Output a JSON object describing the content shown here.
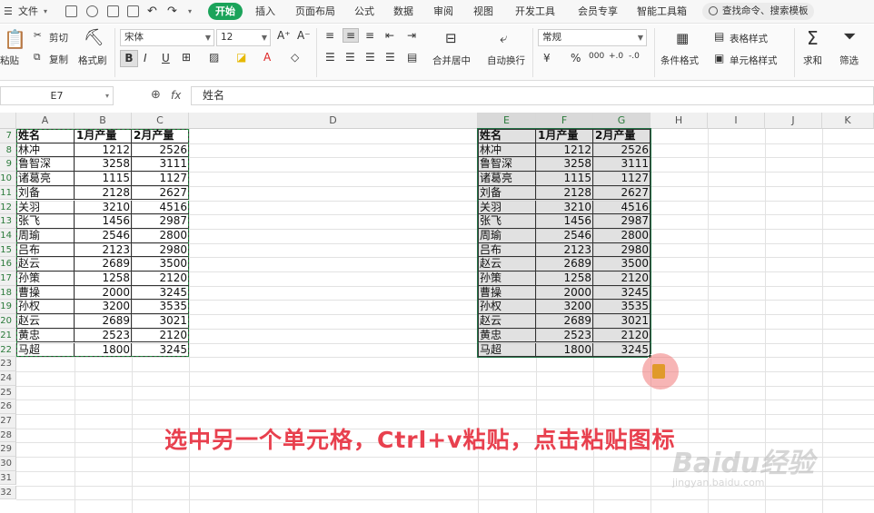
{
  "menubar": {
    "file": "文件",
    "tabs": [
      "开始",
      "插入",
      "页面布局",
      "公式",
      "数据",
      "审阅",
      "视图",
      "开发工具",
      "会员专享",
      "智能工具箱"
    ],
    "search": "查找命令、搜索模板"
  },
  "ribbon": {
    "paste": "粘贴",
    "cut": "剪切",
    "copy": "复制",
    "format_painter": "格式刷",
    "font_name": "宋体",
    "font_size": "12",
    "merge": "合并居中",
    "wrap": "自动换行",
    "number_format": "常规",
    "cond_format": "条件格式",
    "table_style": "表格样式",
    "cell_style": "单元格样式",
    "sum": "求和",
    "filter": "筛选",
    "currency": "¥",
    "percent": "%"
  },
  "formula_bar": {
    "name_box": "E7",
    "fx": "fx",
    "content": "姓名"
  },
  "grid": {
    "columns": [
      "A",
      "B",
      "C",
      "D",
      "E",
      "F",
      "G",
      "H",
      "I",
      "J",
      "K"
    ],
    "rows": [
      "7",
      "8",
      "9",
      "10",
      "11",
      "12",
      "13",
      "14",
      "15",
      "16",
      "17",
      "18",
      "19",
      "20",
      "21",
      "22",
      "23",
      "24",
      "25",
      "26",
      "27",
      "28",
      "29",
      "30",
      "31",
      "32"
    ],
    "headers": [
      "姓名",
      "1月产量",
      "2月产量"
    ],
    "records": [
      [
        "林冲",
        "1212",
        "2526"
      ],
      [
        "鲁智深",
        "3258",
        "3111"
      ],
      [
        "诸葛亮",
        "1115",
        "1127"
      ],
      [
        "刘备",
        "2128",
        "2627"
      ],
      [
        "关羽",
        "3210",
        "4516"
      ],
      [
        "张飞",
        "1456",
        "2987"
      ],
      [
        "周瑜",
        "2546",
        "2800"
      ],
      [
        "吕布",
        "2123",
        "2980"
      ],
      [
        "赵云",
        "2689",
        "3500"
      ],
      [
        "孙策",
        "1258",
        "2120"
      ],
      [
        "曹操",
        "2000",
        "3245"
      ],
      [
        "孙权",
        "3200",
        "3535"
      ],
      [
        "赵云",
        "2689",
        "3021"
      ],
      [
        "黄忠",
        "2523",
        "2120"
      ],
      [
        "马超",
        "1800",
        "3245"
      ]
    ]
  },
  "caption": "选中另一个单元格，Ctrl+v粘贴，点击粘贴图标",
  "watermark": {
    "brand": "Baidu经验",
    "url": "jingyan.baidu.com"
  },
  "colors": {
    "accent": "#1ba35a",
    "selection_border": "#217346",
    "caption": "#e8404e"
  }
}
